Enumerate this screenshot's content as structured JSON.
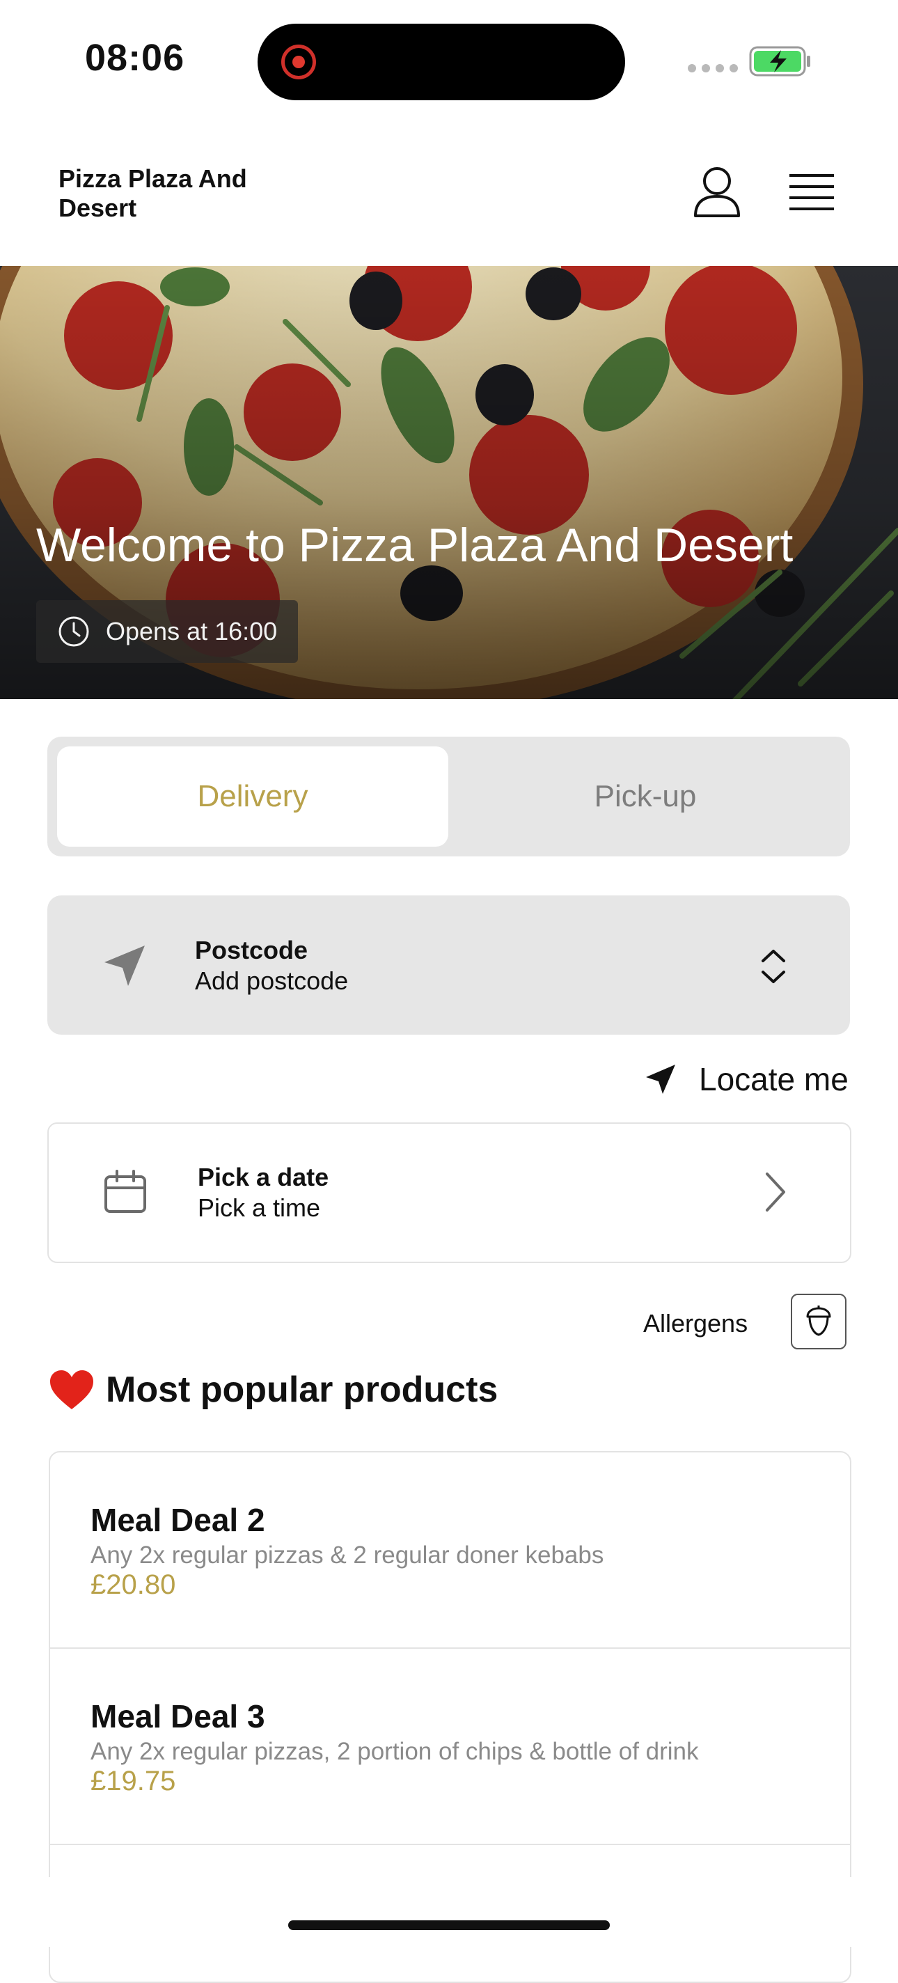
{
  "status_bar": {
    "time": "08:06"
  },
  "header": {
    "title": "Pizza Plaza And Desert"
  },
  "hero": {
    "title": "Welcome to Pizza Plaza And Desert",
    "opening": "Opens at 16:00"
  },
  "order_mode": {
    "tabs": [
      {
        "label": "Delivery",
        "active": true
      },
      {
        "label": "Pick-up",
        "active": false
      }
    ]
  },
  "postcode": {
    "label": "Postcode",
    "placeholder": "Add postcode"
  },
  "locate": {
    "label": "Locate me"
  },
  "schedule": {
    "date_label": "Pick a date",
    "time_label": "Pick a time"
  },
  "allergens": {
    "label": "Allergens"
  },
  "section": {
    "title": "Most popular products"
  },
  "products": [
    {
      "name": "Meal Deal 2",
      "description": "Any 2x regular pizzas & 2 regular doner kebabs",
      "price": "£20.80"
    },
    {
      "name": "Meal Deal 3",
      "description": "Any 2x regular pizzas, 2 portion of chips & bottle of drink",
      "price": "£19.75"
    }
  ],
  "colors": {
    "accent": "#b8a14a",
    "panel": "#e6e6e6",
    "recording": "#e0392f",
    "battery": "#4cd964"
  }
}
